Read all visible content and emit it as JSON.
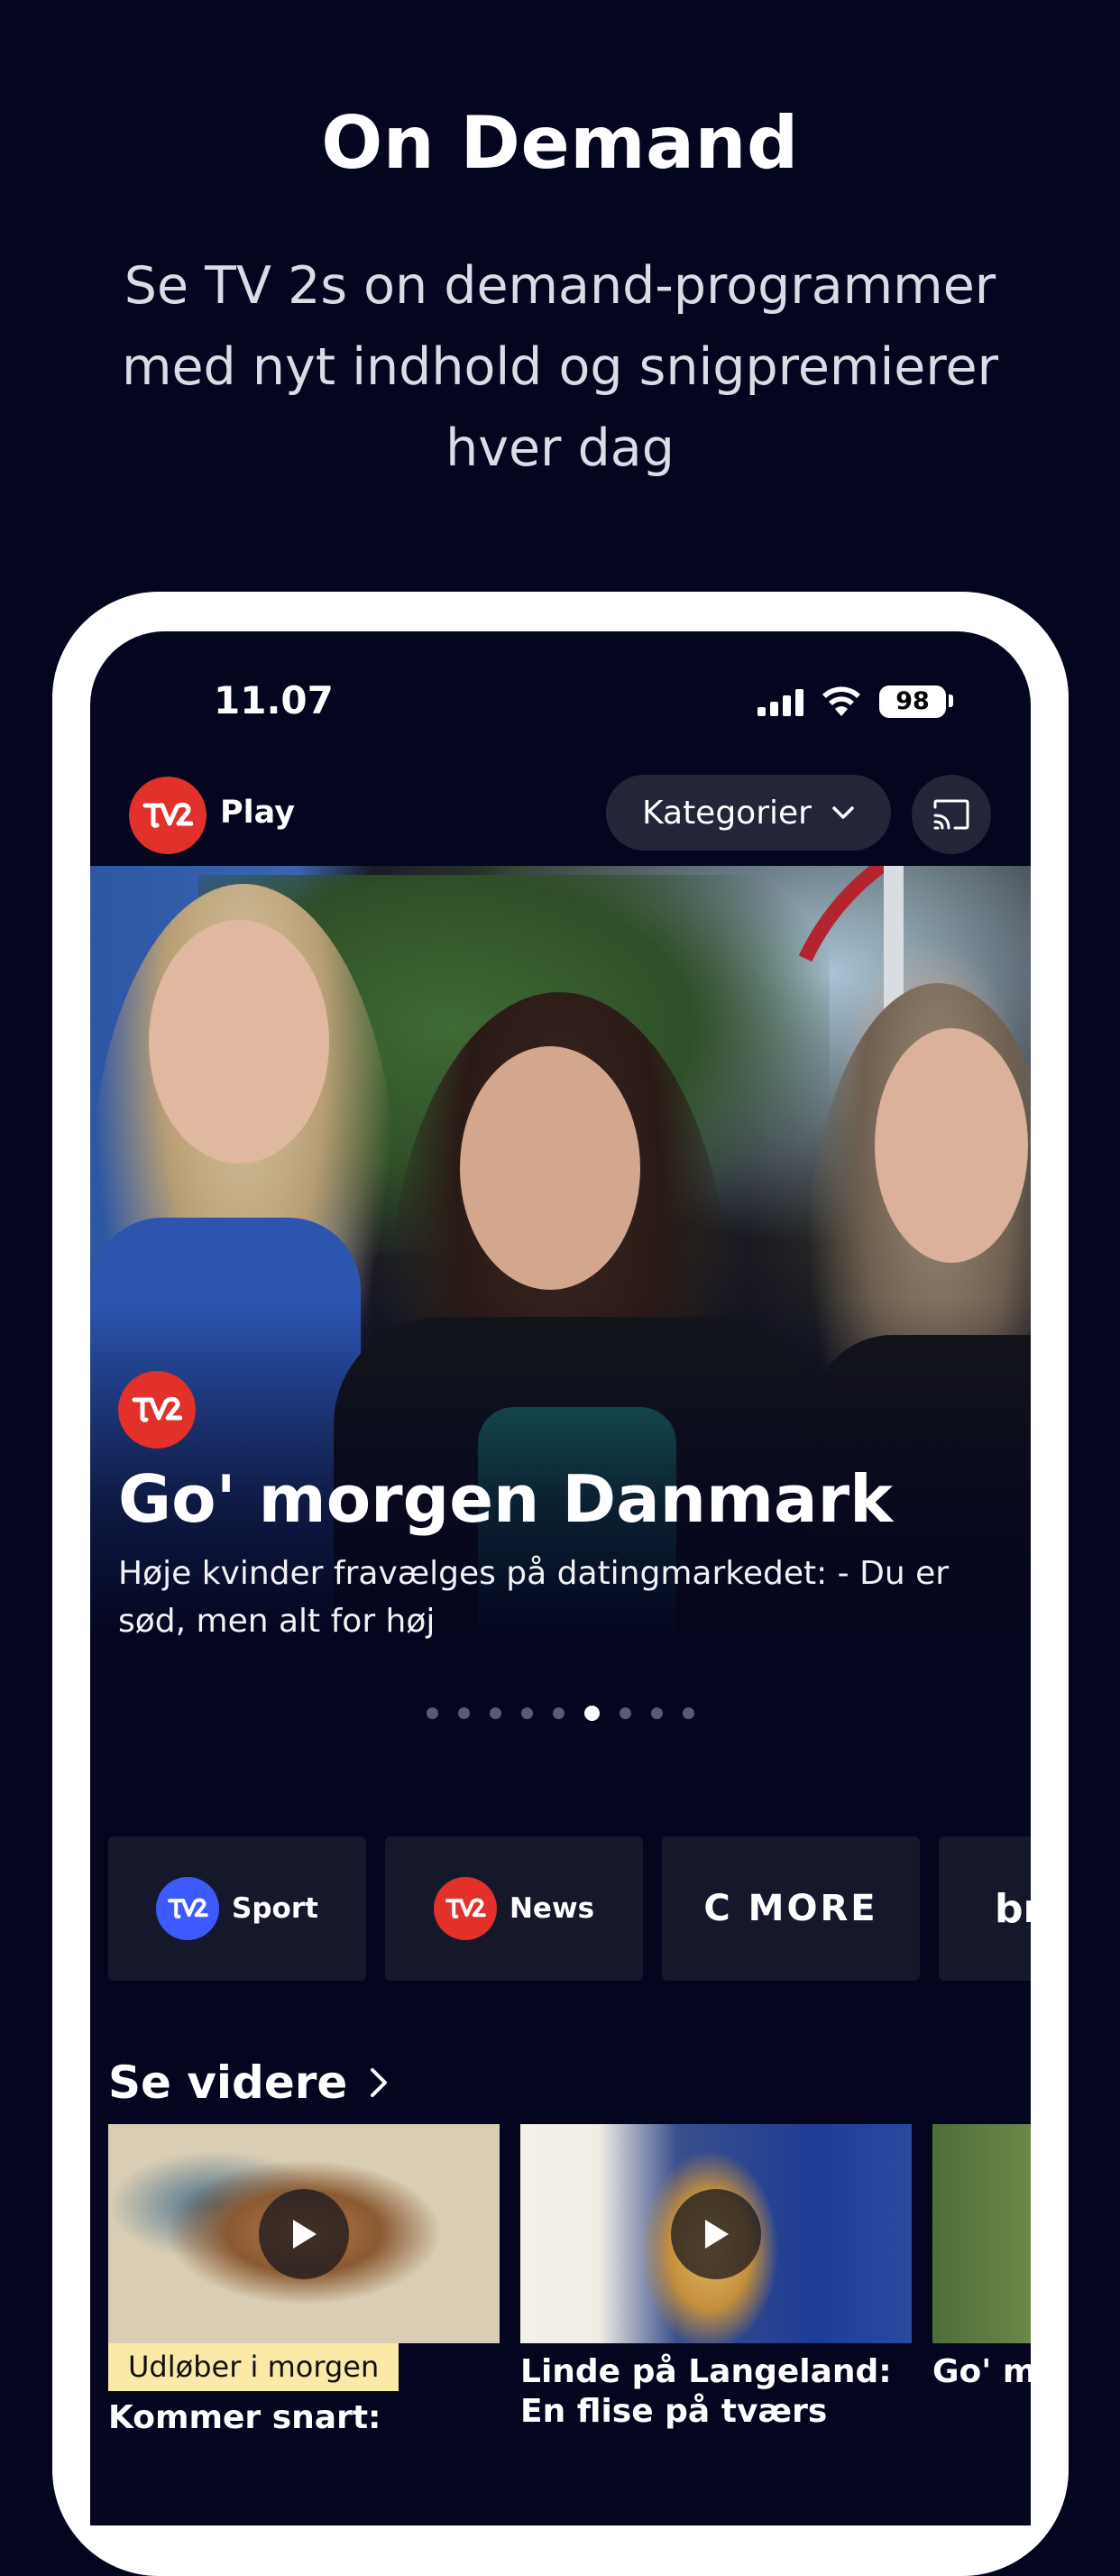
{
  "promo": {
    "title": "On Demand",
    "subtitle": "Se TV 2s on demand-programmer med nyt indhold og snigpremierer hver dag"
  },
  "status_bar": {
    "time": "11.07",
    "battery": "98"
  },
  "header": {
    "logo_text": "TV2",
    "app_name": "Play",
    "categories_label": "Kategorier",
    "cast_icon": "cast-icon"
  },
  "hero": {
    "channel_logo": "TV2",
    "title": "Go' morgen Danmark",
    "description": "Høje kvinder fravælges på datingmarkedet: - Du er sød, men alt for høj",
    "slide_count": 9,
    "active_slide": 6
  },
  "channels": [
    {
      "name": "Sport",
      "badge_color": "#3d5afe"
    },
    {
      "name": "News",
      "badge_color": "#e2302a"
    },
    {
      "name": "C MORE"
    },
    {
      "name": "br"
    }
  ],
  "continue_watching": {
    "title": "Se videre",
    "items": [
      {
        "badge": "Udløber i morgen",
        "title": "Kommer snart:"
      },
      {
        "title": "Linde på Langeland: En flise på tværs"
      },
      {
        "title": "Go' morgen Musik"
      }
    ]
  },
  "colors": {
    "background": "#04051e",
    "tv2_red": "#e2302a",
    "pill_bg": "#242539",
    "badge_yellow": "#fbe9a8"
  }
}
